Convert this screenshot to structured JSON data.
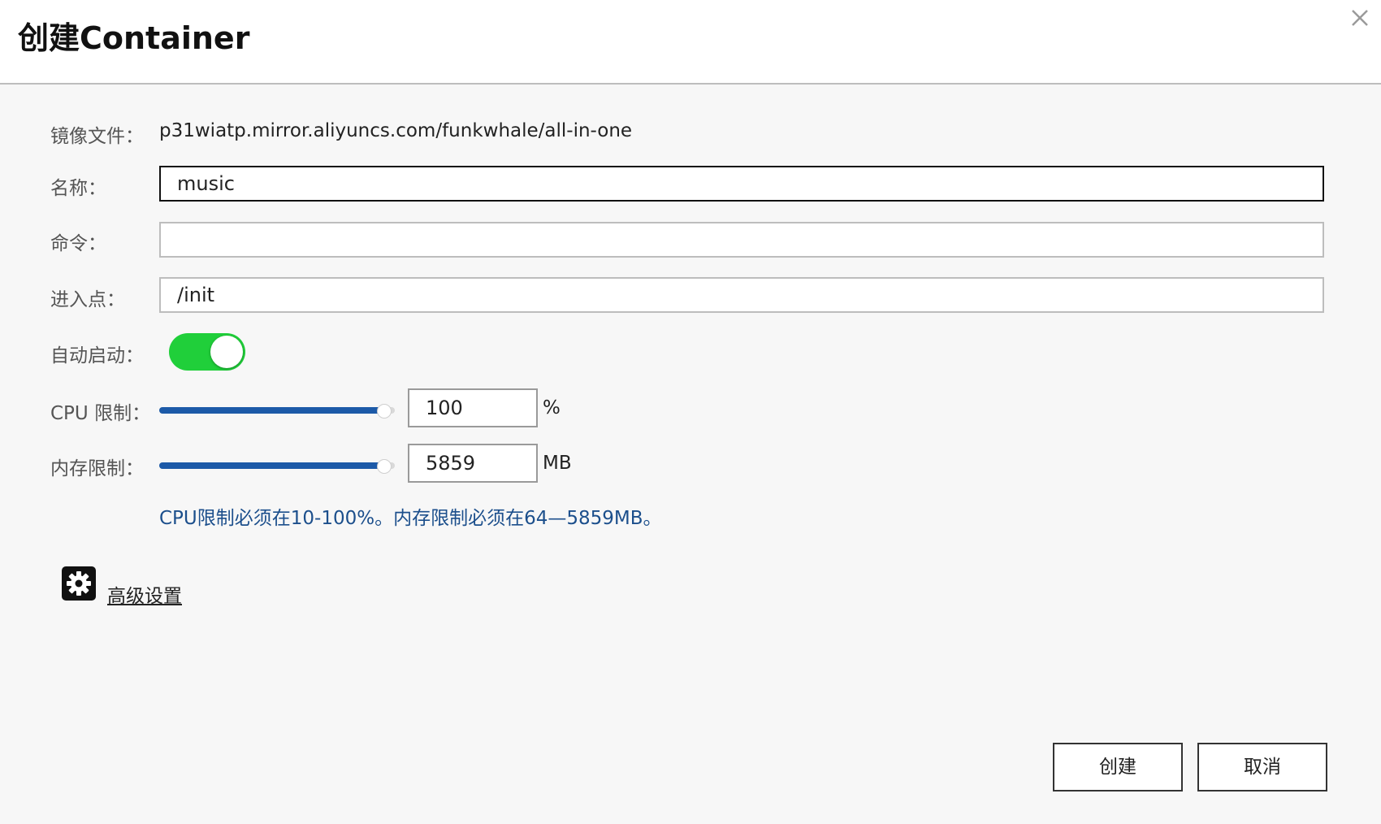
{
  "dialog": {
    "title": "创建Container",
    "close_icon": "close-icon"
  },
  "form": {
    "image_label": "镜像文件：",
    "image_value": "p31wiatp.mirror.aliyuncs.com/funkwhale/all-in-one",
    "name_label": "名称：",
    "name_value": "music",
    "command_label": "命令：",
    "command_value": "",
    "entrypoint_label": "进入点：",
    "entrypoint_value": "/init",
    "autostart_label": "自动启动：",
    "autostart_on": true,
    "cpu_label": "CPU 限制：",
    "cpu_value": "100",
    "cpu_unit": "%",
    "cpu_slider_fraction": 1.0,
    "mem_label": "内存限制：",
    "mem_value": "5859",
    "mem_unit": "MB",
    "mem_slider_fraction": 1.0,
    "hint": "CPU限制必须在10-100%。内存限制必须在64—5859MB。"
  },
  "advanced": {
    "icon": "gear-icon",
    "label": "高级设置"
  },
  "buttons": {
    "create": "创建",
    "cancel": "取消"
  },
  "colors": {
    "toggle_on": "#20cf3a",
    "slider_fill": "#1c5aa8",
    "hint_text": "#1c4f8c"
  }
}
